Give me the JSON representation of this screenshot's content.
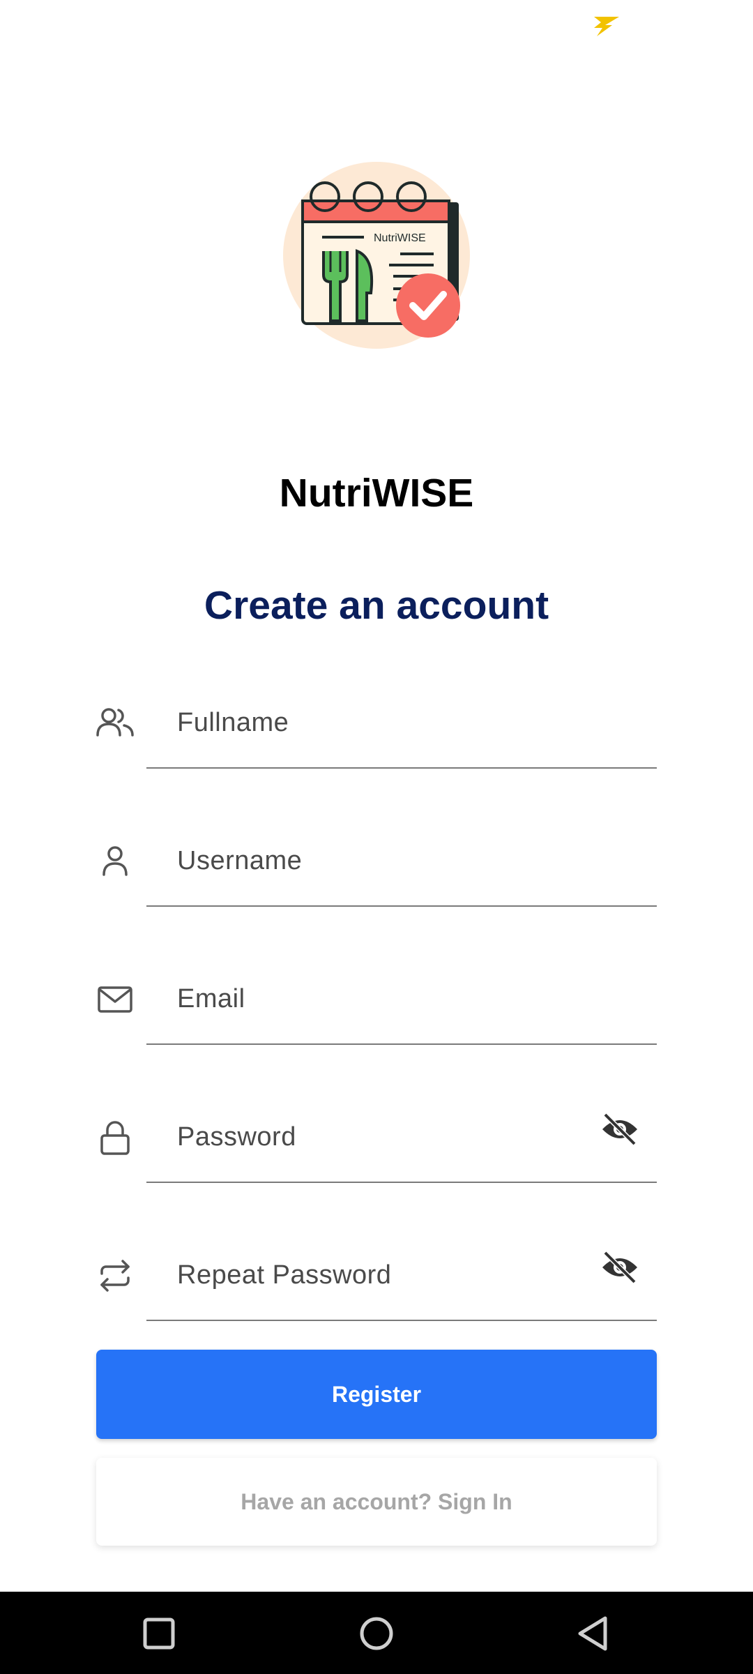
{
  "status_bar": {
    "icon": "flash-icon"
  },
  "logo": {
    "text": "NutriWISE",
    "icon": "meal-plan-calendar-logo"
  },
  "app_name": "NutriWISE",
  "title": "Create an account",
  "fields": [
    {
      "placeholder": "Fullname",
      "value": "",
      "icon": "people-icon"
    },
    {
      "placeholder": "Username",
      "value": "",
      "icon": "person-icon"
    },
    {
      "placeholder": "Email",
      "value": "",
      "icon": "mail-icon"
    },
    {
      "placeholder": "Password",
      "value": "",
      "icon": "lock-icon",
      "toggle_icon": "eye-off-icon"
    },
    {
      "placeholder": "Repeat Password",
      "value": "",
      "icon": "repeat-icon",
      "toggle_icon": "eye-off-icon"
    }
  ],
  "buttons": {
    "register": "Register",
    "signin": "Have an account? Sign In"
  },
  "nav": {
    "recent": "square-icon",
    "home": "circle-icon",
    "back": "triangle-back-icon"
  },
  "colors": {
    "primary": "#2673f7",
    "title": "#0b1f5c",
    "logo_background": "#fde9d5",
    "logo_accent": "#f76d64",
    "logo_green": "#5cbf5c"
  }
}
